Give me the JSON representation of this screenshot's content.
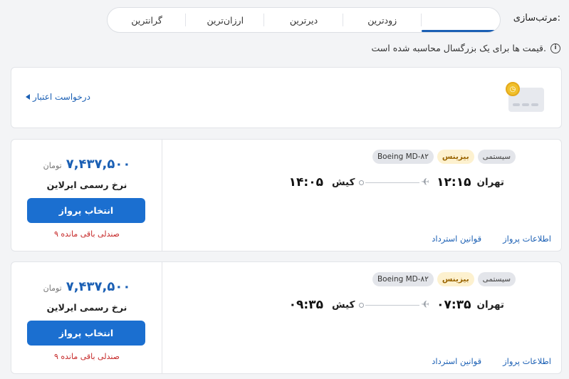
{
  "sort": {
    "label": "مرتب‌سازی:",
    "tabs": [
      {
        "label": "",
        "active": true
      },
      {
        "label": "زودترین",
        "active": false
      },
      {
        "label": "دیرترین",
        "active": false
      },
      {
        "label": "ارزان‌ترین",
        "active": false
      },
      {
        "label": "گرانترین",
        "active": false
      }
    ]
  },
  "notice": {
    "text": "قیمت ها برای یک بزرگسال محاسبه شده است.",
    "icon": "info-icon"
  },
  "credit_banner": {
    "link_label": "درخواست اعتبار",
    "icon": "credit-card-icon"
  },
  "flights": [
    {
      "price": "۷,۴۳۷,۵۰۰",
      "currency": "تومان",
      "fare": "نرخ رسمی ایرلاین",
      "select_label": "انتخاب پرواز",
      "seats": "۹ صندلی باقی مانده",
      "badges": {
        "system": "سیستمی",
        "class": "بیزینس",
        "aircraft": "Boeing MD-۸۲"
      },
      "origin": "تهران",
      "departure_time": "۱۲:۱۵",
      "destination": "کیش",
      "arrival_time": "۱۴:۰۵",
      "links": {
        "info": "اطلاعات پرواز",
        "refund": "قوانین استرداد"
      }
    },
    {
      "price": "۷,۴۳۷,۵۰۰",
      "currency": "تومان",
      "fare": "نرخ رسمی ایرلاین",
      "select_label": "انتخاب پرواز",
      "seats": "۹ صندلی باقی مانده",
      "badges": {
        "system": "سیستمی",
        "class": "بیزینس",
        "aircraft": "Boeing MD-۸۲"
      },
      "origin": "تهران",
      "departure_time": "۰۷:۳۵",
      "destination": "کیش",
      "arrival_time": "۰۹:۳۵",
      "links": {
        "info": "اطلاعات پرواز",
        "refund": "قوانین استرداد"
      }
    }
  ],
  "colors": {
    "accent": "#1a5fb4",
    "button": "#1b6fd0",
    "seats": "#c62828",
    "business": "#fdf1cf"
  }
}
